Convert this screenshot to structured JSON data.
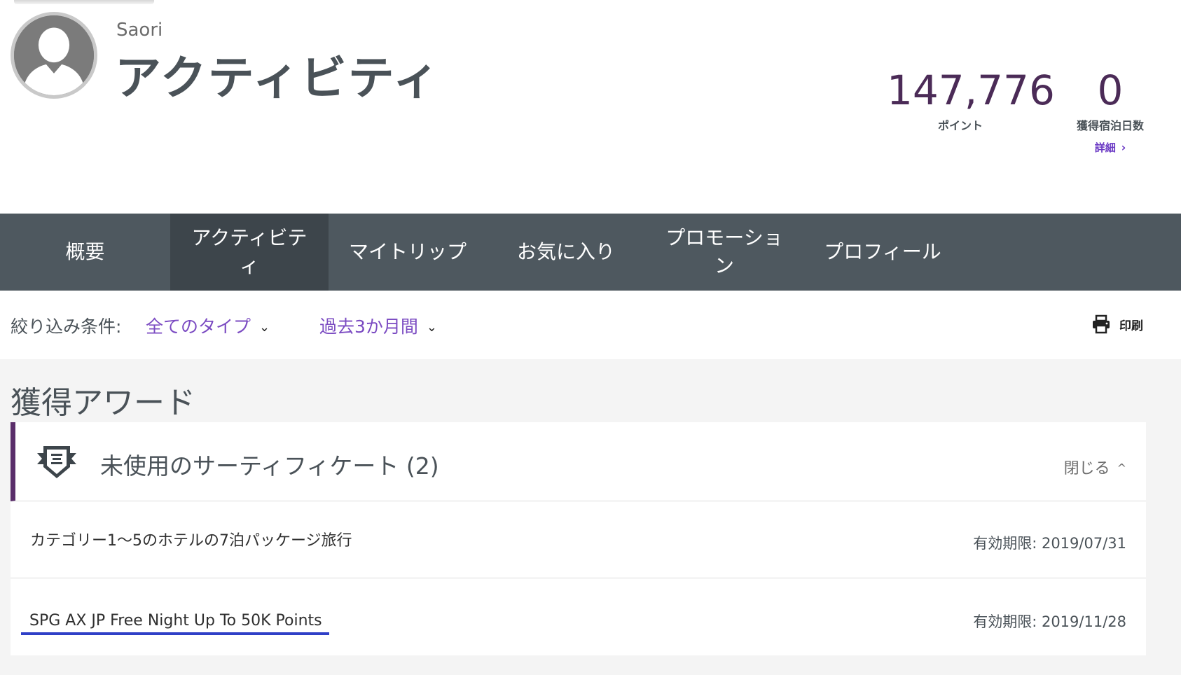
{
  "header": {
    "user_name": "Saori",
    "title": "アクティビティ",
    "points_value": "147,776",
    "points_label": "ポイント",
    "nights_value": "0",
    "nights_label": "獲得宿泊日数",
    "details_link": "詳細"
  },
  "nav": {
    "tabs": [
      {
        "label": "概要",
        "active": false
      },
      {
        "label": "アクティビテ\nィ",
        "active": true
      },
      {
        "label": "マイトリップ",
        "active": false
      },
      {
        "label": "お気に入り",
        "active": false
      },
      {
        "label": "プロモーショ\nン",
        "active": false
      },
      {
        "label": "プロフィール",
        "active": false
      }
    ]
  },
  "filters": {
    "label": "絞り込み条件:",
    "type_value": "全てのタイプ",
    "period_value": "過去3か月間",
    "print_label": "印刷"
  },
  "awards": {
    "section_title": "獲得アワード",
    "card_title": "未使用のサーティフィケート (2)",
    "collapse_label": "閉じる",
    "items": [
      {
        "title": "カテゴリー1～5のホテルの7泊パッケージ旅行",
        "expiry": "有効期限: 2019/07/31"
      },
      {
        "title": "SPG AX JP Free Night Up To 50K Points",
        "expiry": "有効期限: 2019/11/28"
      }
    ]
  },
  "colors": {
    "accent_purple": "#6a38c4",
    "stat_purple": "#4b2b57",
    "nav_bg": "#4e585f",
    "nav_active_bg": "#3d454b",
    "card_border": "#5a2e6a",
    "link_underline": "#2f3fc7"
  },
  "icons": {
    "avatar": "user-silhouette-icon",
    "details": "chevron-right-icon",
    "dropdown": "chevron-down-icon",
    "print": "printer-icon",
    "certificate": "certificate-badge-icon",
    "collapse": "chevron-up-icon"
  }
}
